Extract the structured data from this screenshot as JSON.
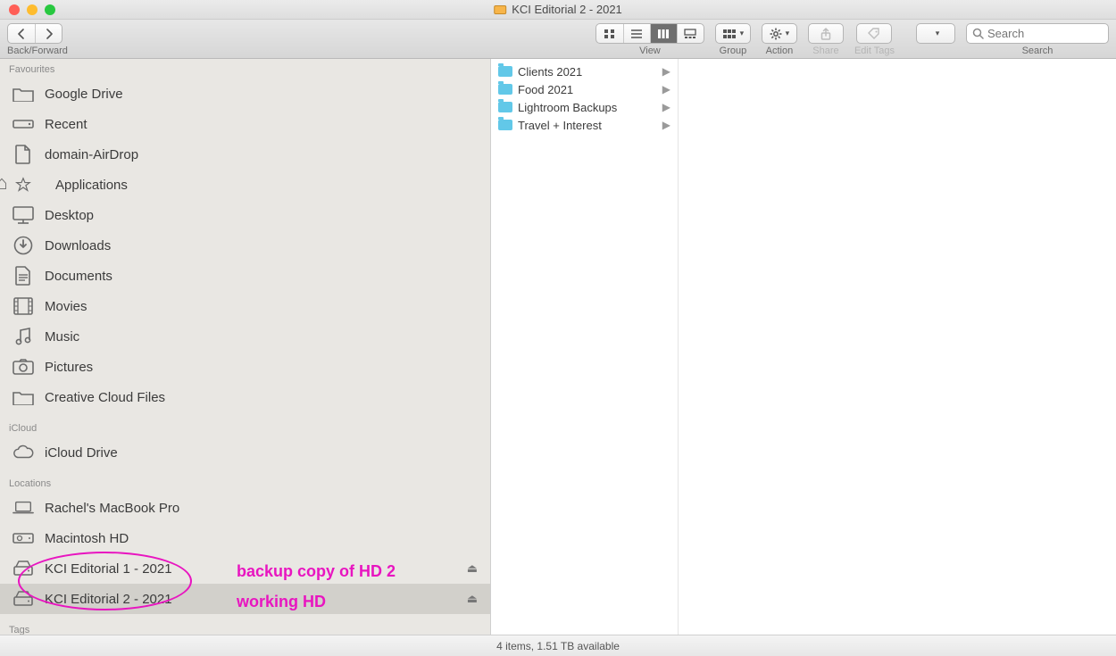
{
  "window": {
    "title": "KCI Editorial 2 - 2021"
  },
  "toolbar": {
    "back_forward_label": "Back/Forward",
    "view_label": "View",
    "group_label": "Group",
    "action_label": "Action",
    "share_label": "Share",
    "edit_tags_label": "Edit Tags",
    "search_label": "Search",
    "search_placeholder": "Search",
    "blank_select_value": ""
  },
  "sidebar": {
    "sections": {
      "favourites": {
        "label": "Favourites"
      },
      "icloud": {
        "label": "iCloud"
      },
      "locations": {
        "label": "Locations"
      },
      "tags": {
        "label": "Tags"
      }
    },
    "favourites": [
      {
        "label": "Google Drive",
        "icon": "folder"
      },
      {
        "label": "Recent",
        "icon": "drive"
      },
      {
        "label": "domain-AirDrop",
        "icon": "file"
      },
      {
        "label": "Applications",
        "icon": "apps"
      },
      {
        "label": "Desktop",
        "icon": "desktop"
      },
      {
        "label": "Downloads",
        "icon": "downloads"
      },
      {
        "label": "Documents",
        "icon": "documents"
      },
      {
        "label": "Movies",
        "icon": "movies"
      },
      {
        "label": "Music",
        "icon": "music"
      },
      {
        "label": "Pictures",
        "icon": "pictures"
      },
      {
        "label": "Creative Cloud Files",
        "icon": "folder"
      }
    ],
    "icloud": [
      {
        "label": "iCloud Drive",
        "icon": "cloud"
      }
    ],
    "locations": [
      {
        "label": "Rachel's MacBook Pro",
        "icon": "laptop",
        "eject": false
      },
      {
        "label": "Macintosh HD",
        "icon": "hd",
        "eject": false
      },
      {
        "label": "KCI Editorial 1 - 2021",
        "icon": "ext",
        "eject": true
      },
      {
        "label": "KCI Editorial 2 - 2021",
        "icon": "ext",
        "eject": true,
        "selected": true
      }
    ]
  },
  "column": {
    "items": [
      {
        "label": "Clients 2021"
      },
      {
        "label": "Food 2021"
      },
      {
        "label": "Lightroom Backups"
      },
      {
        "label": "Travel + Interest"
      }
    ]
  },
  "status": {
    "text": "4 items, 1.51 TB available"
  },
  "annotations": {
    "line1": "backup copy of HD 2",
    "line2": "working HD"
  }
}
